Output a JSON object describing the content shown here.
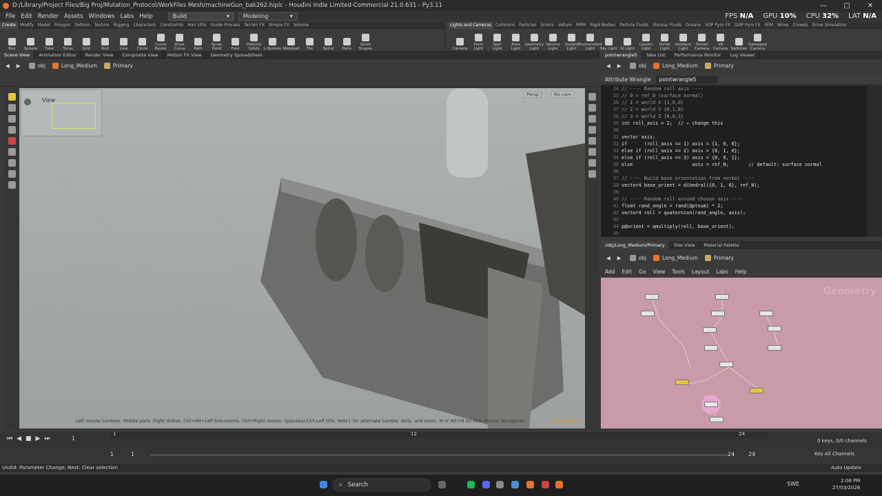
{
  "window": {
    "title": "D:/Library/Project Files/Big Proj/Mutation_Protocol/WorkFiles Mesh/machineGun_bak262.hiplc - Houdini Indie Limited-Commercial 21.0.631 - Py3.11",
    "minimize": "—",
    "maximize": "▢",
    "close": "✕"
  },
  "menu": {
    "items": [
      "File",
      "Edit",
      "Render",
      "Assets",
      "Windows",
      "Labs",
      "Help"
    ],
    "desktop": "Build",
    "desktop2": "Modeling"
  },
  "stats": {
    "fps_label": "FPS",
    "fps": "N/A",
    "gpu_label": "GPU",
    "gpu": "10%",
    "cpu_label": "CPU",
    "cpu": "32%",
    "lat_label": "LAT",
    "lat": "N/A"
  },
  "shelf_left": {
    "tabs": [
      "Create",
      "Modify",
      "Model",
      "Polygon",
      "Deform",
      "Texture",
      "Rigging",
      "Characters",
      "Constraints",
      "Hair Utils",
      "Guide Process",
      "Terrain FX",
      "Simple FX",
      "Volume"
    ],
    "tools": [
      "Box",
      "Sphere",
      "Tube",
      "Torus",
      "Grid",
      "Null",
      "Line",
      "Circle",
      "Curve Bezier",
      "Draw Curve",
      "Path",
      "Spray Paint",
      "Font",
      "Platonic Solids",
      "L-System",
      "Metaball",
      "File",
      "Spiral",
      "Helix",
      "Quick Shapes"
    ]
  },
  "shelf_right": {
    "tabs": [
      "Lights and Cameras",
      "Collisions",
      "Particles",
      "Grains",
      "Vellum",
      "MPM",
      "Rigid Bodies",
      "Particle Fluids",
      "Viscous Fluids",
      "Oceans",
      "SOP Pyro FX",
      "DOP Pyro FX",
      "FEM",
      "Wires",
      "Crowds",
      "Drive Simulation"
    ],
    "tools": [
      "Camera",
      "Point Light",
      "Spot Light",
      "Area Light",
      "Geometry Light",
      "Volume Light",
      "Distant Light",
      "Environment Light",
      "Sky Light",
      "GI Light",
      "Caustic Light",
      "Portal Light",
      "Ambient Light",
      "Stereo Camera",
      "VR Camera",
      "Switcher",
      "Gamepad Camera"
    ]
  },
  "pane_tabs_left": [
    "Scene View",
    "Animation Editor",
    "Render View",
    "Composite View",
    "Motion FX View",
    "Geometry Spreadsheet"
  ],
  "pane_tabs_right": [
    "pointwrangle5",
    "Take List",
    "Performance Monitor",
    "Log Viewer"
  ],
  "path": {
    "root": "obj",
    "object": "Long_Medium",
    "context": "Primary"
  },
  "viewport": {
    "view_label": "View",
    "persp": "Persp",
    "cam": "No cam",
    "hint": "Left mouse tumbles. Middle pans. Right dollies. Ctrl+Alt+Left box-zooms. Ctrl+Right zooms. Spacebar-Ctrl-Left tilts. Hold L for alternate tumble, dolly, and zoom. M or Alt+M for First Person Navigation.",
    "edition": "Indie Edition"
  },
  "wrangle": {
    "type_label": "Attribute Wrangle",
    "node_name": "pointwrangle5"
  },
  "code": [
    {
      "n": "24",
      "t": "// ---- Random roll axis ----",
      "c": true
    },
    {
      "n": "25",
      "t": "// 0 = ref_N (surface normal)",
      "c": true
    },
    {
      "n": "26",
      "t": "// 1 = world X {1,0,0}",
      "c": true
    },
    {
      "n": "27",
      "t": "// 2 = world Y {0,1,0}",
      "c": true
    },
    {
      "n": "28",
      "t": "// 3 = world Z {0,0,1}",
      "c": true
    },
    {
      "n": "29",
      "t": "int roll_axis = 2;  // ← change this",
      "c": false
    },
    {
      "n": "30",
      "t": "",
      "c": false
    },
    {
      "n": "31",
      "t": "vector axis;",
      "c": false
    },
    {
      "n": "32",
      "t": "if      (roll_axis == 1) axis = {1, 0, 0};",
      "c": false
    },
    {
      "n": "33",
      "t": "else if (roll_axis == 2) axis = {0, 1, 0};",
      "c": false
    },
    {
      "n": "34",
      "t": "else if (roll_axis == 3) axis = {0, 0, 1};",
      "c": false
    },
    {
      "n": "35",
      "t": "else                     axis = ref_N;       // default: surface normal",
      "c": false
    },
    {
      "n": "36",
      "t": "",
      "c": false
    },
    {
      "n": "37",
      "t": "// ---- Build base orientation from normal ----",
      "c": true
    },
    {
      "n": "38",
      "t": "vector4 base_orient = dihedral({0, 1, 0}, ref_N);",
      "c": false
    },
    {
      "n": "39",
      "t": "",
      "c": false
    },
    {
      "n": "40",
      "t": "// ---- Random roll around chosen axis ----",
      "c": true
    },
    {
      "n": "41",
      "t": "float rand_angle = rand(@ptnum) * 2;",
      "c": false
    },
    {
      "n": "42",
      "t": "vector4 roll = quaternion(rand_angle, axis);",
      "c": false
    },
    {
      "n": "43",
      "t": "",
      "c": false
    },
    {
      "n": "44",
      "t": "p@orient = qmultiply(roll, base_orient);",
      "c": false
    },
    {
      "n": "45",
      "t": "",
      "c": false
    }
  ],
  "network_tabs": [
    "/obj/Long_Medium/Primary",
    "Tree View",
    "Material Palette"
  ],
  "network_menu": [
    "Add",
    "Edit",
    "Go",
    "View",
    "Tools",
    "Layout",
    "Labs",
    "Help"
  ],
  "network": {
    "context_label": "Geometry"
  },
  "timeline": {
    "frame": "1",
    "start": "1",
    "start2": "1",
    "end": "24",
    "end2": "24",
    "ticks": [
      "1",
      "12",
      "24"
    ],
    "keys": "0 keys, 0/0 channels",
    "channels": "Key All Channels",
    "autoupdate": "Auto Update"
  },
  "status": {
    "text": "Undid: Parameter Change; Next: Clear selection"
  },
  "taskbar": {
    "search": "Search",
    "lang": "SWE",
    "time": "2:08 PM",
    "date": "27/03/2026"
  },
  "colors": {
    "accent": "#e8742c",
    "network_bg": "#c99aa7",
    "viewport_bg": "#a9aeac"
  }
}
